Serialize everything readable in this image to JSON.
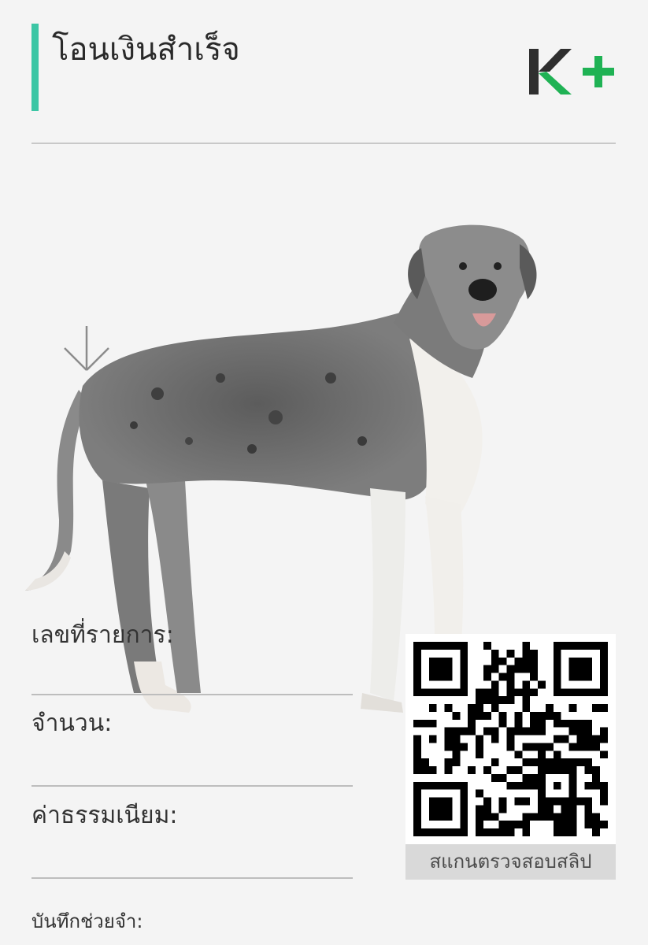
{
  "header": {
    "title": "โอนเงินสำเร็จ",
    "logo_text": "K+",
    "accent_color": "#3cc6a5",
    "brand_green": "#1fb254"
  },
  "fields": [
    {
      "label": "เลขที่รายการ:"
    },
    {
      "label": "จำนวน:"
    },
    {
      "label": "ค่าธรรมเนียม:"
    },
    {
      "label": "บันทึกช่วยจำ:"
    }
  ],
  "qr": {
    "caption": "สแกนตรวจสอบสลิป"
  },
  "icons": {
    "arrow": "arrow-down-icon",
    "logo": "k-plus-logo-icon"
  }
}
